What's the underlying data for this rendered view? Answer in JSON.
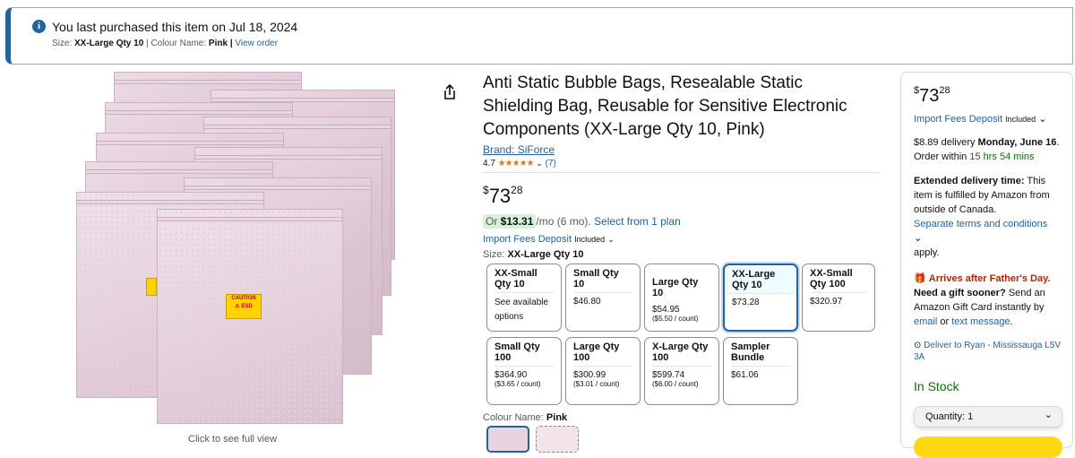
{
  "banner": {
    "title": "You last purchased this item on Jul 18, 2024",
    "size_label": "Size:",
    "size_value": "XX-Large Qty 10",
    "sep1": " | ",
    "colour_label": "Colour Name:",
    "colour_value": "Pink",
    "sep2": " | ",
    "view_order": "View order"
  },
  "gallery": {
    "click_full": "Click to see full view"
  },
  "product": {
    "title": "Anti Static Bubble Bags, Resealable Static Shielding Bag, Reusable for Sensitive Electronic Components (XX-Large Qty 10, Pink)",
    "brand": "Brand: SiForce",
    "rating": "4.7",
    "stars": "★★★★★",
    "rating_count": "(7)",
    "price": {
      "symbol": "$",
      "whole": "73",
      "fraction": "28"
    },
    "emi": {
      "prefix": "Or ",
      "amount": "$13.31",
      "per": "/mo",
      "term": " (6 mo). ",
      "plan_link": "Select from 1 plan"
    },
    "import_fees": "Import Fees Deposit",
    "included": "Included",
    "size_label": "Size: ",
    "size_value": "XX-Large Qty 10",
    "options": [
      {
        "name": "XX-Small Qty 10",
        "price": "",
        "unit": "",
        "note": "See available options"
      },
      {
        "name": "Small Qty 10",
        "price": "$46.80",
        "unit": "",
        "note": ""
      },
      {
        "name": "Large Qty 10",
        "price": "$54.95",
        "unit": "($5.50 / count)",
        "note": ""
      },
      {
        "name": "XX-Large Qty 10",
        "price": "$73.28",
        "unit": "",
        "note": ""
      },
      {
        "name": "XX-Small Qty 100",
        "price": "$320.97",
        "unit": "",
        "note": ""
      },
      {
        "name": "Small Qty 100",
        "price": "$364.90",
        "unit": "($3.65 / count)",
        "note": ""
      },
      {
        "name": "Large Qty 100",
        "price": "$300.99",
        "unit": "($3.01 / count)",
        "note": ""
      },
      {
        "name": "X-Large Qty 100",
        "price": "$599.74",
        "unit": "($6.00 / count)",
        "note": ""
      },
      {
        "name": "Sampler Bundle",
        "price": "$61.06",
        "unit": "",
        "note": ""
      }
    ],
    "colour_label": "Colour Name: ",
    "colour_value": "Pink"
  },
  "buybox": {
    "price": {
      "symbol": "$",
      "whole": "73",
      "fraction": "28"
    },
    "import_fees": "Import Fees Deposit",
    "included": "Included",
    "delivery_fee": "$8.89 delivery ",
    "delivery_date": "Monday, June 16",
    ". ": ". ",
    "order_within": "Order within ",
    "countdown": "15 hrs 54 mins",
    "ext_title": "Extended delivery time:",
    "ext_text": " This item is fulfilled by Amazon from outside of Canada.",
    "terms_link": "Separate terms and conditions",
    "apply": "apply.",
    "gift_title": "Arrives after Father's Day.",
    "gift_q": "Need a gift sooner?",
    "gift_text": " Send an Amazon Gift Card instantly by ",
    "email": "email",
    "or": " or ",
    "text_msg": "text message",
    ".": ".",
    "deliver_to": "Deliver to Ryan - Mississauga L5V 3A",
    "stock": "In Stock",
    "quantity": "Quantity: 1"
  },
  "colors": {
    "accent": "#2162a1",
    "star": "#de7921",
    "stock": "#007600",
    "warn": "#b12704",
    "cart": "#ffd814"
  }
}
